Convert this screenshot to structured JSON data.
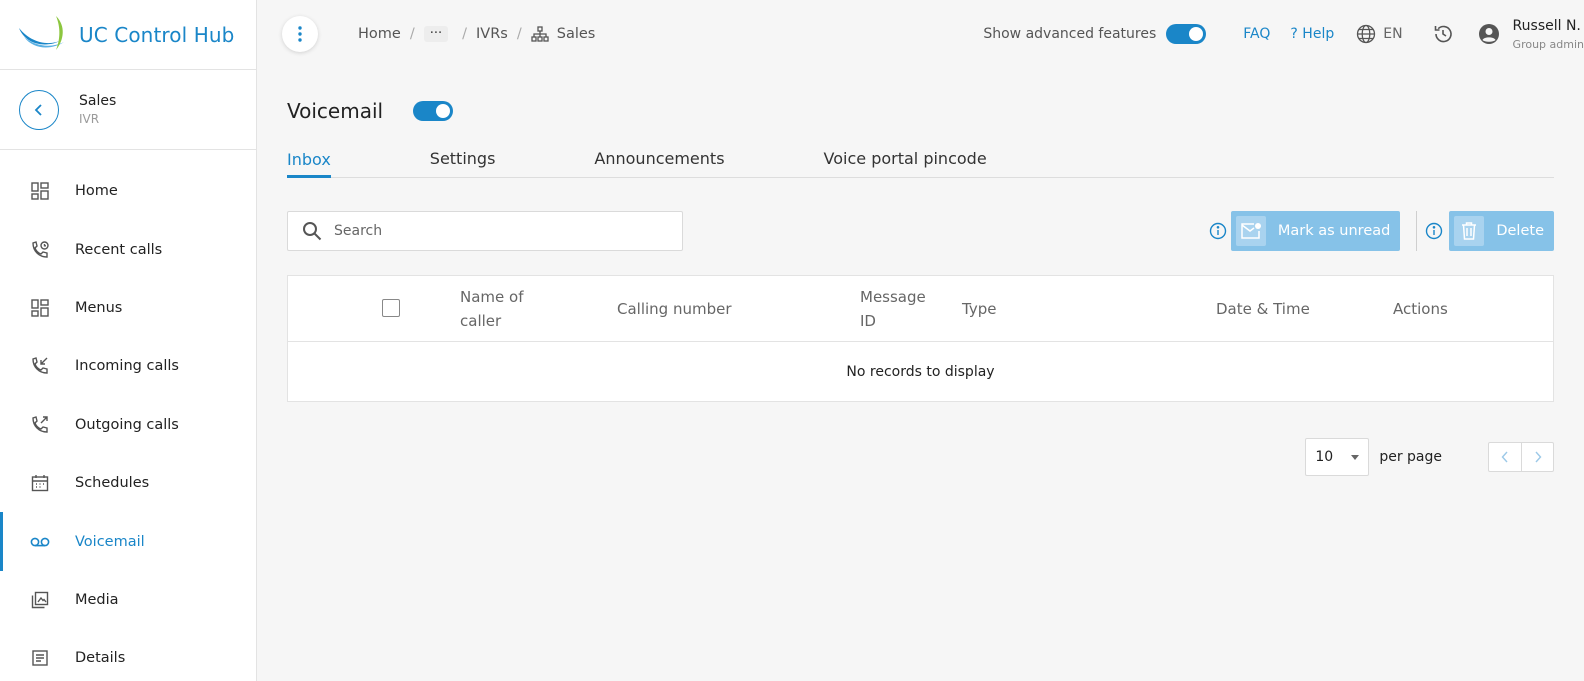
{
  "app": {
    "name": "UC Control Hub"
  },
  "context": {
    "name": "Sales",
    "type": "IVR"
  },
  "sidebar": {
    "items": [
      {
        "label": "Home",
        "icon": "dashboard-icon"
      },
      {
        "label": "Recent calls",
        "icon": "phone-history-icon"
      },
      {
        "label": "Menus",
        "icon": "dashboard-icon"
      },
      {
        "label": "Incoming calls",
        "icon": "phone-incoming-icon"
      },
      {
        "label": "Outgoing calls",
        "icon": "phone-outgoing-icon"
      },
      {
        "label": "Schedules",
        "icon": "calendar-icon"
      },
      {
        "label": "Voicemail",
        "icon": "voicemail-icon",
        "active": true
      },
      {
        "label": "Media",
        "icon": "media-library-icon"
      },
      {
        "label": "Details",
        "icon": "document-icon"
      }
    ]
  },
  "breadcrumb": {
    "home": "Home",
    "ellipsis": "···",
    "ivrs": "IVRs",
    "current": "Sales"
  },
  "topbar": {
    "advanced_label": "Show advanced features",
    "advanced_on": true,
    "faq": "FAQ",
    "help": "Help",
    "help_prefix": "?",
    "language": "EN",
    "user_name": "Russell N.",
    "user_role": "Group admin"
  },
  "page": {
    "title": "Voicemail",
    "enabled": true,
    "tabs": [
      {
        "label": "Inbox",
        "active": true
      },
      {
        "label": "Settings"
      },
      {
        "label": "Announcements"
      },
      {
        "label": "Voice portal pincode"
      }
    ]
  },
  "search": {
    "placeholder": "Search",
    "value": ""
  },
  "actions": {
    "mark_unread": "Mark as unread",
    "delete": "Delete"
  },
  "table": {
    "columns": [
      "Name of caller",
      "Calling number",
      "Message ID",
      "Type",
      "Date & Time",
      "Actions"
    ],
    "empty_text": "No records to display"
  },
  "pagination": {
    "per_page_value": "10",
    "per_page_label": "per page"
  },
  "colors": {
    "accent": "#1a86c8",
    "button_disabled": "#86c2e8"
  }
}
